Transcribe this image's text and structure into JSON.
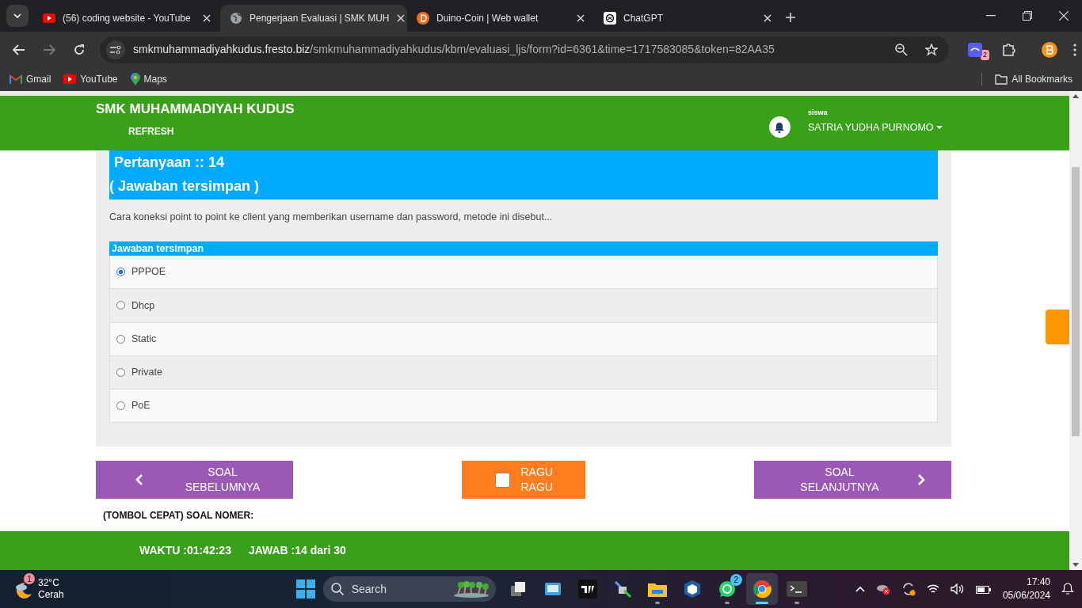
{
  "browser": {
    "tabs": [
      {
        "kind": "youtube",
        "title": "(56) coding website - YouTube",
        "selected": false
      },
      {
        "kind": "globe",
        "title": "Pengerjaan Evaluasi | SMK MUH",
        "selected": true
      },
      {
        "kind": "duino",
        "title": "Duino-Coin | Web wallet",
        "selected": false
      },
      {
        "kind": "chatgpt",
        "title": "ChatGPT",
        "selected": false
      }
    ],
    "address": {
      "host": "smkmuhammadiyahkudus.fresto.biz",
      "path": "/smkmuhammadiyahkudus/kbm/evaluasi_ljs/form?id=6361&time=1717583085&token=82AA35"
    },
    "extension_badge": "2",
    "bookmarks": [
      {
        "kind": "gmail",
        "label": "Gmail"
      },
      {
        "kind": "youtube",
        "label": "YouTube"
      },
      {
        "kind": "maps",
        "label": "Maps"
      }
    ],
    "all_bookmarks": "All Bookmarks"
  },
  "page": {
    "header": {
      "school": "SMK MUHAMMADIYAH KUDUS",
      "refresh": "REFRESH",
      "role": "siswa",
      "user": "SATRIA YUDHA PURNOMO"
    },
    "question": {
      "title": "Pertanyaan :: 14",
      "status": "( Jawaban tersimpan )",
      "text": "Cara koneksi point to point ke client yang memberikan username dan password, metode ini disebut...",
      "answer_header": "Jawaban tersimpan",
      "options": [
        {
          "label": "PPPOE",
          "selected": true
        },
        {
          "label": "Dhcp",
          "selected": false
        },
        {
          "label": "Static",
          "selected": false
        },
        {
          "label": "Private",
          "selected": false
        },
        {
          "label": "PoE",
          "selected": false
        }
      ]
    },
    "nav": {
      "prev": "SOAL SEBELUMNYA",
      "doubt": {
        "label": "RAGU RAGU",
        "checked": false
      },
      "next": "SOAL SELANJUTNYA"
    },
    "quick_nav": "(TOMBOL CEPAT) SOAL NOMER:",
    "footer": {
      "time": "WAKTU :01:42:23",
      "answered": "JAWAB :14 dari 30"
    }
  },
  "taskbar": {
    "weather": {
      "badge": "1",
      "temperature": "32°C",
      "condition": "Cerah"
    },
    "search": {
      "placeholder": "Search"
    },
    "apps": [
      {
        "kind": "taskview",
        "running": false,
        "selected": false
      },
      {
        "kind": "remote",
        "running": false,
        "selected": false
      },
      {
        "kind": "chart",
        "running": false,
        "selected": false
      },
      {
        "kind": "network",
        "running": false,
        "selected": false
      },
      {
        "kind": "folder",
        "running": true,
        "selected": false
      },
      {
        "kind": "cube",
        "running": false,
        "selected": false
      },
      {
        "kind": "chat",
        "running": true,
        "selected": false,
        "badge": "2"
      },
      {
        "kind": "chrome",
        "running": true,
        "selected": true
      },
      {
        "kind": "terminal",
        "running": true,
        "selected": false
      }
    ],
    "time": "17:40",
    "date": "05/06/2024"
  }
}
